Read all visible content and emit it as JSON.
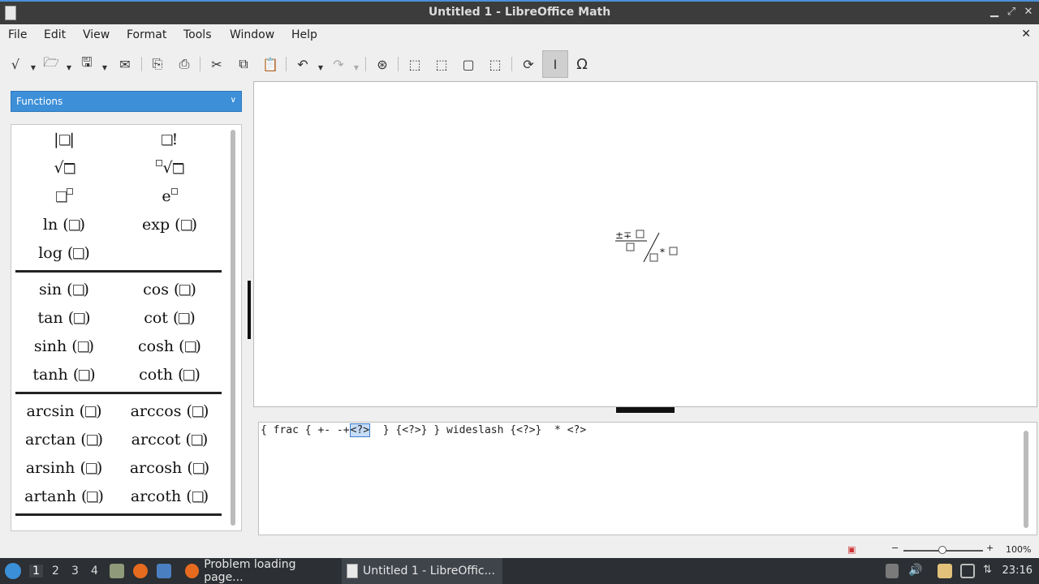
{
  "window": {
    "title": "Untitled 1 - LibreOffice Math",
    "min_icon": "minimize-icon",
    "max_icon": "maximize-icon",
    "close_icon": "close-icon"
  },
  "menu": [
    "File",
    "Edit",
    "View",
    "Format",
    "Tools",
    "Window",
    "Help"
  ],
  "toolbar": {
    "icons": [
      "formula-icon",
      "open-icon",
      "save-icon",
      "export-icon",
      "export-pdf-icon",
      "print-icon",
      "cut-icon",
      "copy-icon",
      "paste-icon",
      "undo-icon",
      "redo-icon",
      "zoom-100-icon",
      "zoom-in-icon",
      "zoom-out-icon",
      "show-all-icon",
      "zoom-icon",
      "update-icon",
      "formula-cursor-icon",
      "symbols-icon"
    ]
  },
  "elements_panel": {
    "category": "Functions",
    "groups": [
      [
        {
          "text": "|",
          "tail": "|"
        },
        {
          "text": "",
          "tail": "!"
        }
      ],
      [
        {
          "text": "√",
          "tail": ""
        },
        {
          "text": "ⁿ√",
          "tail": ""
        }
      ],
      [
        {
          "text": "",
          "tail": "sup"
        },
        {
          "text": "e",
          "tail": "sup"
        }
      ],
      [
        {
          "text": "ln",
          "tail": "()"
        },
        {
          "text": "exp",
          "tail": "()"
        }
      ],
      [
        {
          "text": "log",
          "tail": "()"
        }
      ],
      [
        {
          "text": "sin",
          "tail": "()"
        },
        {
          "text": "cos",
          "tail": "()"
        }
      ],
      [
        {
          "text": "tan",
          "tail": "()"
        },
        {
          "text": "cot",
          "tail": "()"
        }
      ],
      [
        {
          "text": "sinh",
          "tail": "()"
        },
        {
          "text": "cosh",
          "tail": "()"
        }
      ],
      [
        {
          "text": "tanh",
          "tail": "()"
        },
        {
          "text": "coth",
          "tail": "()"
        }
      ],
      [
        {
          "text": "arcsin",
          "tail": "()"
        },
        {
          "text": "arccos",
          "tail": "()"
        }
      ],
      [
        {
          "text": "arctan",
          "tail": "()"
        },
        {
          "text": "arccot",
          "tail": "()"
        }
      ],
      [
        {
          "text": "arsinh",
          "tail": "()"
        },
        {
          "text": "arcosh",
          "tail": "()"
        }
      ],
      [
        {
          "text": "artanh",
          "tail": "()"
        },
        {
          "text": "arcoth",
          "tail": "()"
        }
      ]
    ]
  },
  "editor": {
    "before": "{ frac { +- -+",
    "selected": "<?>",
    "after": "  } {<?>} } wideslash {<?>}  * <?>"
  },
  "statusbar": {
    "zoom": "100%"
  },
  "taskbar": {
    "workspaces": [
      "1",
      "2",
      "3",
      "4"
    ],
    "tasks": [
      {
        "label": "Problem loading page...",
        "icon": "firefox-icon"
      },
      {
        "label": "Untitled 1 - LibreOffic...",
        "icon": "libreoffice-icon"
      }
    ],
    "clock": "23:16"
  }
}
